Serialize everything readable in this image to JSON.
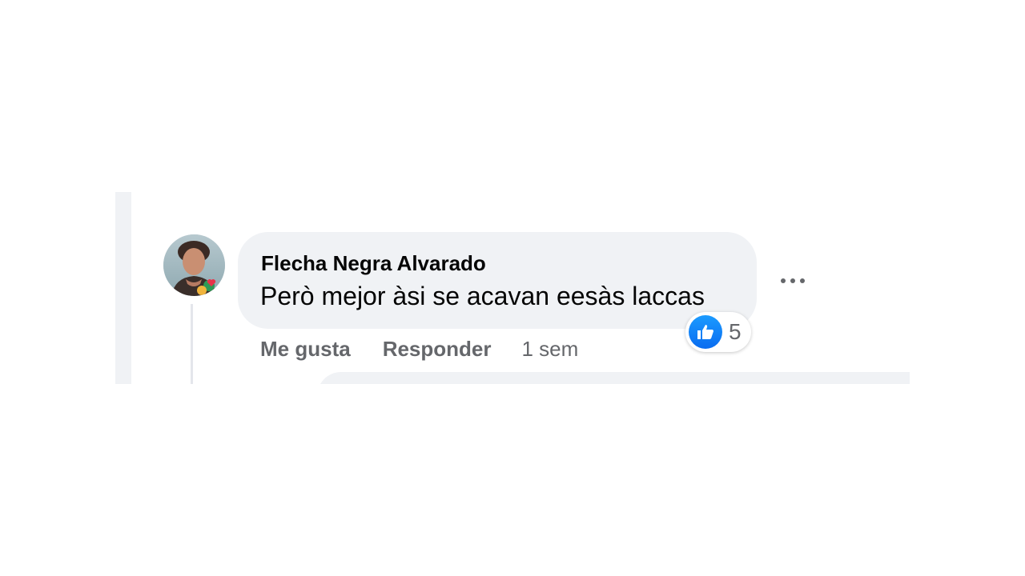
{
  "comment": {
    "author": "Flecha Negra Alvarado",
    "text": "Però mejor àsi se acavan eesàs laccas",
    "avatar_icon": "profile-photo",
    "avatar_badge_icon": "heart-badge-icon",
    "reactions": {
      "icon": "like-icon",
      "count": "5"
    },
    "actions": {
      "like_label": "Me gusta",
      "reply_label": "Responder",
      "timestamp": "1 sem"
    },
    "more_icon": "more-options-icon"
  },
  "colors": {
    "bubble": "#f0f2f5",
    "text": "#050505",
    "secondary_text": "#65676b",
    "like_blue": "#0a6cf0"
  }
}
